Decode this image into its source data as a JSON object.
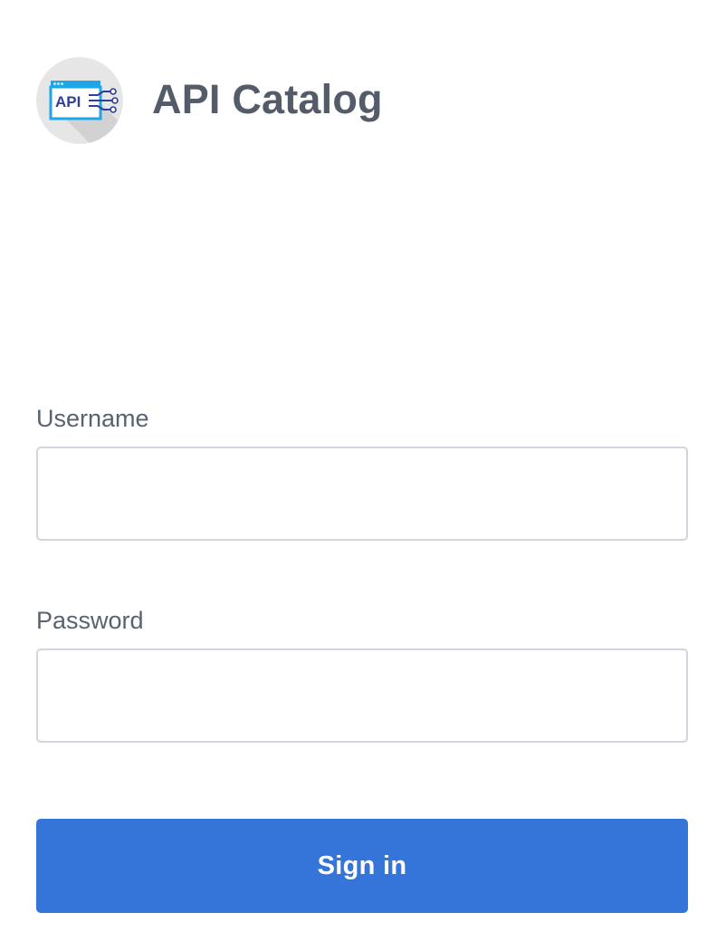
{
  "header": {
    "logo_icon": "api-catalog-logo-icon",
    "logo_text": "API",
    "title": "API Catalog"
  },
  "form": {
    "username": {
      "label": "Username",
      "value": "",
      "placeholder": ""
    },
    "password": {
      "label": "Password",
      "value": "",
      "placeholder": ""
    },
    "submit_label": "Sign in"
  },
  "colors": {
    "primary": "#3574d9",
    "text": "#5a6270",
    "title": "#555c69",
    "input_border": "#cfd6df",
    "logo_bg": "#e6e6e6",
    "logo_accent": "#1ea7e8",
    "logo_text": "#2f3e99"
  }
}
